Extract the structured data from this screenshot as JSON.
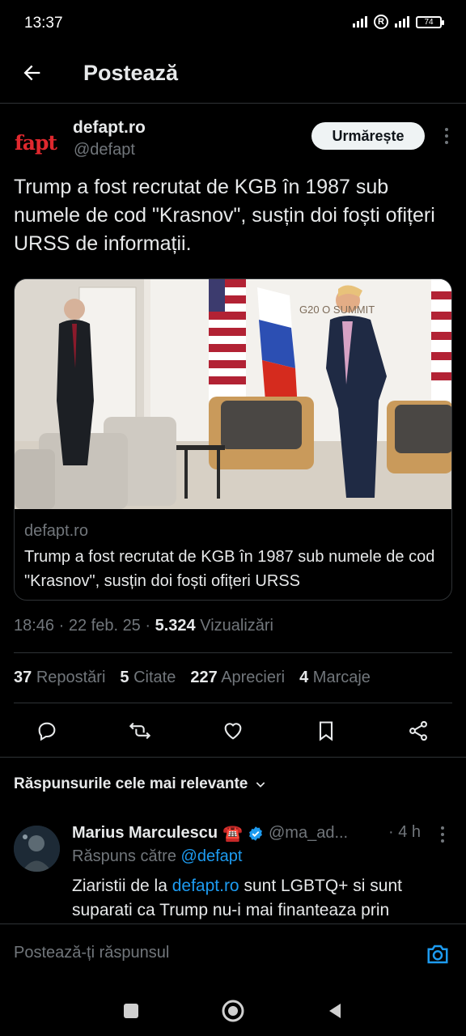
{
  "status_bar": {
    "time": "13:37",
    "battery": "74"
  },
  "header": {
    "title": "Postează",
    "back_icon": "arrow-left-icon"
  },
  "tweet": {
    "author_logo": "fapt",
    "author_name": "defapt.ro",
    "author_handle": "@defapt",
    "follow_label": "Urmărește",
    "text": "Trump a fost recrutat de KGB în 1987 sub numele de cod \"Krasnov\", susțin doi foști ofițeri URSS de informații.",
    "card": {
      "image_text": "G20 O    SUMMIT",
      "domain": "defapt.ro",
      "title": "Trump a fost recrutat de KGB în 1987 sub numele de cod \"Krasnov\", susțin doi foști ofițeri URSS"
    },
    "time": "18:46",
    "date": "22 feb. 25",
    "views_count": "5.324",
    "views_label": "Vizualizări",
    "stats": {
      "reposts_count": "37",
      "reposts_label": "Repostări",
      "quotes_count": "5",
      "quotes_label": "Citate",
      "likes_count": "227",
      "likes_label": "Aprecieri",
      "bookmarks_count": "4",
      "bookmarks_label": "Marcaje"
    },
    "actions": [
      "reply-icon",
      "repost-icon",
      "like-icon",
      "bookmark-icon",
      "share-icon"
    ]
  },
  "replies": {
    "sort_label": "Răspunsurile cele mai relevante",
    "items": [
      {
        "name": "Marius Marculescu",
        "emoji": "☎️",
        "handle": "@ma_ad...",
        "time": "· 4 h",
        "reply_to_prefix": "Răspuns către",
        "reply_to_handle": "@defapt",
        "text_before": "Ziaristii de la",
        "text_link": "defapt.ro",
        "text_after": "sunt LGBTQ+ si sunt suparati ca Trump nu-i mai finanteaza prin"
      }
    ]
  },
  "composer": {
    "placeholder": "Postează-ți răspunsul"
  },
  "colors": {
    "background": "#000000",
    "text": "#e7e9ea",
    "secondary": "#71767b",
    "accent": "#1d9bf0",
    "border": "#2f3336",
    "logo": "#e0282e"
  }
}
